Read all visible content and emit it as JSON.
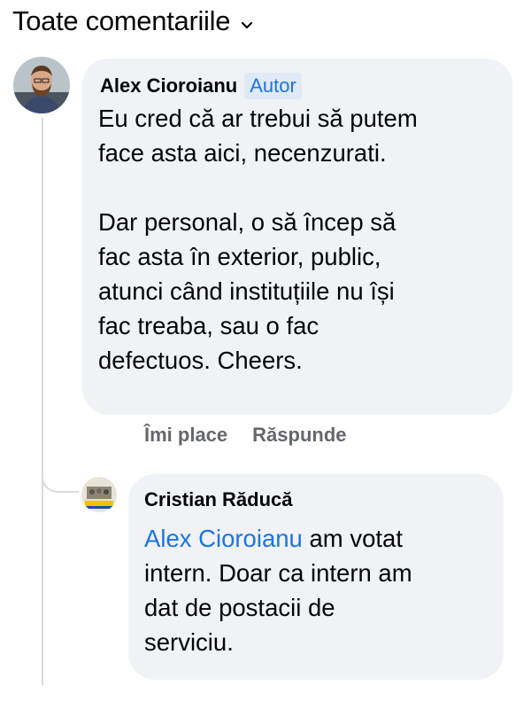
{
  "header": {
    "title": "Toate comentariile"
  },
  "comments": [
    {
      "author": "Alex Cioroianu",
      "badge": "Autor",
      "text": "Eu cred că ar trebui să putem\nface asta aici, necenzurati.\n\nDar personal, o să încep să\nfac asta în exterior, public,\natunci când instituțiile nu își\nfac treaba, sau o fac\ndefectuos. Cheers.",
      "actions": {
        "like": "Îmi place",
        "reply": "Răspunde"
      }
    }
  ],
  "replies": [
    {
      "author": "Cristian Răducă",
      "mention": "Alex Cioroianu",
      "text": " am votat\nintern. Doar ca intern am\ndat de postacii de\nserviciu."
    }
  ],
  "colors": {
    "accent": "#1b74e4",
    "bubble": "#f0f2f5",
    "muted": "#65676b"
  }
}
